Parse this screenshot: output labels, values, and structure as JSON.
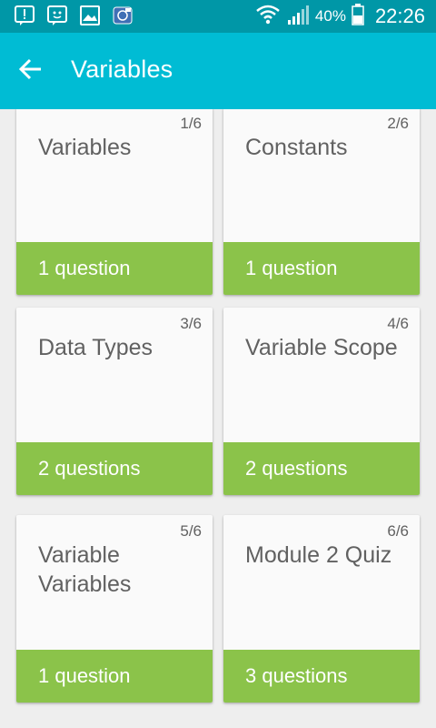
{
  "status_bar": {
    "battery": "40%",
    "time": "22:26",
    "icons": [
      "alert-icon",
      "messenger-icon",
      "gallery-icon",
      "app-icon",
      "wifi-icon",
      "signal-icon",
      "battery-icon"
    ]
  },
  "app_bar": {
    "title": "Variables",
    "back_icon": "arrow-back-icon"
  },
  "colors": {
    "status_bar": "#0097a7",
    "app_bar": "#00bcd4",
    "card_footer": "#8bc34a",
    "background": "#eeeeee"
  },
  "cards": [
    {
      "index": "1/6",
      "title": "Variables",
      "count": "1 question"
    },
    {
      "index": "2/6",
      "title": "Constants",
      "count": "1 question"
    },
    {
      "index": "3/6",
      "title": "Data Types",
      "count": "2 questions"
    },
    {
      "index": "4/6",
      "title": "Variable Scope",
      "count": "2 questions"
    },
    {
      "index": "5/6",
      "title": "Variable Variables",
      "count": "1 question"
    },
    {
      "index": "6/6",
      "title": "Module 2 Quiz",
      "count": "3 questions"
    }
  ]
}
